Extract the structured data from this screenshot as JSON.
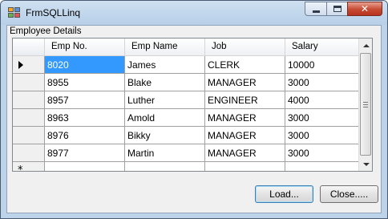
{
  "window": {
    "title": "FrmSQLLinq"
  },
  "groupbox": {
    "label": "Employee Details"
  },
  "grid": {
    "columns": [
      "Emp No.",
      "Emp Name",
      "Job",
      "Salary"
    ],
    "rows": [
      [
        "8020",
        "James",
        "CLERK",
        "10000"
      ],
      [
        "8955",
        "Blake",
        "MANAGER",
        "3000"
      ],
      [
        "8957",
        "Luther",
        "ENGINEER",
        "4000"
      ],
      [
        "8963",
        "Amold",
        "MANAGER",
        "3000"
      ],
      [
        "8976",
        "Bikky",
        "MANAGER",
        "3000"
      ],
      [
        "8977",
        "Martin",
        "MANAGER",
        "3000"
      ]
    ],
    "selected_row": 0,
    "selected_col": 0,
    "new_row_marker": "*"
  },
  "buttons": {
    "load": "Load...",
    "close": "Close....."
  },
  "colors": {
    "selection": "#3399ff",
    "titlebar": "#bcd3ea",
    "close_button": "#c74a33"
  }
}
